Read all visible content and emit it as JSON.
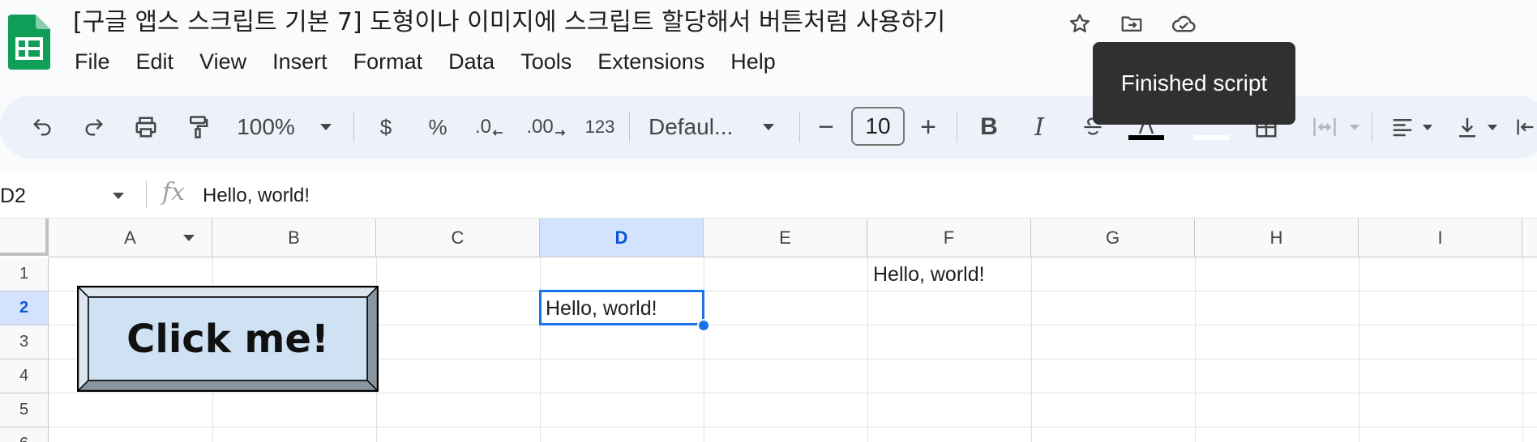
{
  "app": {
    "title": "[구글 앱스 스크립트 기본 7] 도형이나 이미지에 스크립트 할당해서 버튼처럼 사용하기",
    "accent_color": "#0f9d58"
  },
  "title_icons": [
    "star-icon",
    "move-to-folder-icon",
    "cloud-saved-icon"
  ],
  "menu": {
    "items": [
      "File",
      "Edit",
      "View",
      "Insert",
      "Format",
      "Data",
      "Tools",
      "Extensions",
      "Help"
    ]
  },
  "toolbar": {
    "zoom": "100%",
    "currency": "$",
    "percent": "%",
    "decrease_decimal": ".0",
    "increase_decimal": ".00",
    "more_formats": "123",
    "font": "Defaul...",
    "font_size": "10",
    "decrease_size": "−",
    "increase_size": "+",
    "bold": "B",
    "italic": "I"
  },
  "tooltip": {
    "text": "Finished script"
  },
  "formula_bar": {
    "name_box": "D2",
    "fx": "fx",
    "content": "Hello, world!"
  },
  "grid": {
    "columns": [
      "A",
      "B",
      "C",
      "D",
      "E",
      "F",
      "G",
      "H",
      "I"
    ],
    "rows": [
      "1",
      "2",
      "3",
      "4",
      "5",
      "6"
    ],
    "selected_column": "D",
    "selected_row": "2",
    "cells": {
      "F1": "Hello, world!",
      "D2": "Hello, world!"
    },
    "selection_color": "#1a73e8"
  },
  "drawing": {
    "label": "Click me!",
    "face_color": "#cfe2f3",
    "bevel_light": "#dde6ee",
    "bevel_dark": "#8a969f"
  }
}
